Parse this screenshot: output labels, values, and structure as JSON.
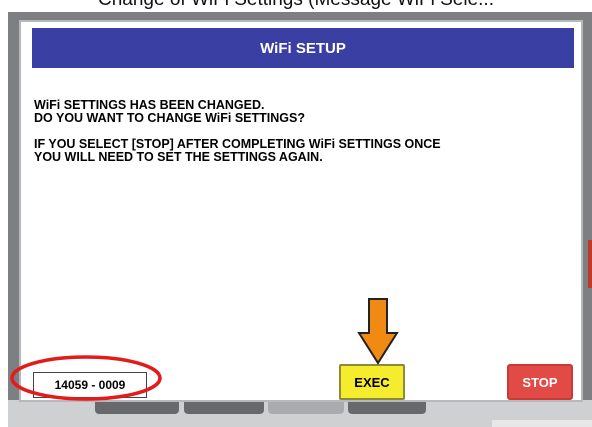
{
  "caption": "Change of WiFi Settings (Message WiFi Sele...",
  "dialog": {
    "title": "WiFi SETUP",
    "message_lines": [
      "WiFi SETTINGS HAS BEEN CHANGED.",
      "DO YOU WANT TO CHANGE WiFi SETTINGS?",
      "IF YOU SELECT [STOP] AFTER COMPLETING WiFi SETTINGS ONCE",
      "YOU WILL NEED TO SET THE SETTINGS AGAIN."
    ],
    "code": "14059 - 0009",
    "buttons": {
      "exec": "EXEC",
      "stop": "STOP"
    }
  },
  "colors": {
    "title_bar": "#3a3fa3",
    "exec_button": "#f6ec2e",
    "stop_button": "#e24a46",
    "annotation_ellipse": "#e21b1b",
    "annotation_arrow": "#f08a12"
  },
  "icons": [
    "annotation-ellipse",
    "annotation-down-arrow"
  ]
}
